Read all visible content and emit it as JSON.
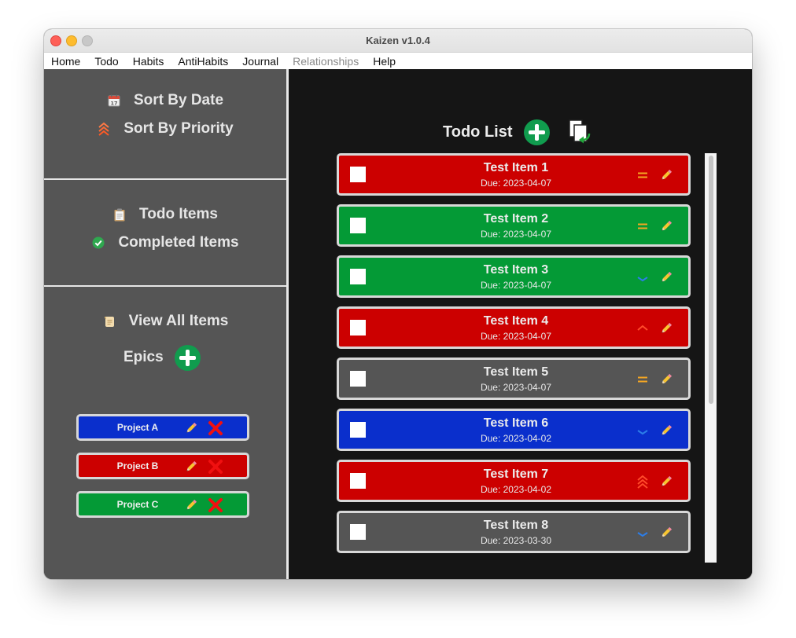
{
  "window": {
    "title": "Kaizen v1.0.4"
  },
  "menu": [
    "Home",
    "Todo",
    "Habits",
    "AntiHabits",
    "Journal",
    "Relationships",
    "Help"
  ],
  "menu_disabled": [
    "Relationships"
  ],
  "sidebar": {
    "sort_by_date": "Sort By Date",
    "sort_by_priority": "Sort By Priority",
    "todo_items": "Todo Items",
    "completed_items": "Completed Items",
    "view_all_items": "View All Items",
    "epics_label": "Epics",
    "epics": [
      {
        "name": "Project A",
        "color": "#0a2fcc"
      },
      {
        "name": "Project B",
        "color": "#cc0000"
      },
      {
        "name": "Project C",
        "color": "#049a36"
      }
    ]
  },
  "main": {
    "header": "Todo List",
    "items": [
      {
        "name": "Test Item 1",
        "due": "Due: 2023-04-07",
        "color": "#cc0000",
        "priority": "medium",
        "done": false
      },
      {
        "name": "Test Item 2",
        "due": "Due: 2023-04-07",
        "color": "#049a36",
        "priority": "medium",
        "done": false
      },
      {
        "name": "Test Item 3",
        "due": "Due: 2023-04-07",
        "color": "#049a36",
        "priority": "low",
        "done": false
      },
      {
        "name": "Test Item 4",
        "due": "Due: 2023-04-07",
        "color": "#cc0000",
        "priority": "high",
        "done": false
      },
      {
        "name": "Test Item 5",
        "due": "Due: 2023-04-07",
        "color": "#555555",
        "priority": "medium",
        "done": false
      },
      {
        "name": "Test Item 6",
        "due": "Due: 2023-04-02",
        "color": "#0a2fcc",
        "priority": "low",
        "done": false
      },
      {
        "name": "Test Item 7",
        "due": "Due: 2023-04-02",
        "color": "#cc0000",
        "priority": "highest",
        "done": false
      },
      {
        "name": "Test Item 8",
        "due": "Due: 2023-03-30",
        "color": "#555555",
        "priority": "low",
        "done": false
      }
    ]
  },
  "colors": {
    "sidebar_bg": "#555555",
    "main_bg": "#151515",
    "accent_green": "#109c4e",
    "priority_medium": "#f5a623",
    "priority_low": "#2c7de8",
    "priority_high": "#ff4a2a"
  },
  "icons": {
    "sort_by_date": "calendar-icon",
    "sort_by_priority": "priority-chevrons-icon",
    "todo_items": "clipboard-icon",
    "completed_items": "check-circle-icon",
    "view_all_items": "scroll-icon",
    "add": "plus-circle-icon",
    "export": "copy-export-icon",
    "edit": "pencil-icon",
    "delete": "x-icon"
  }
}
